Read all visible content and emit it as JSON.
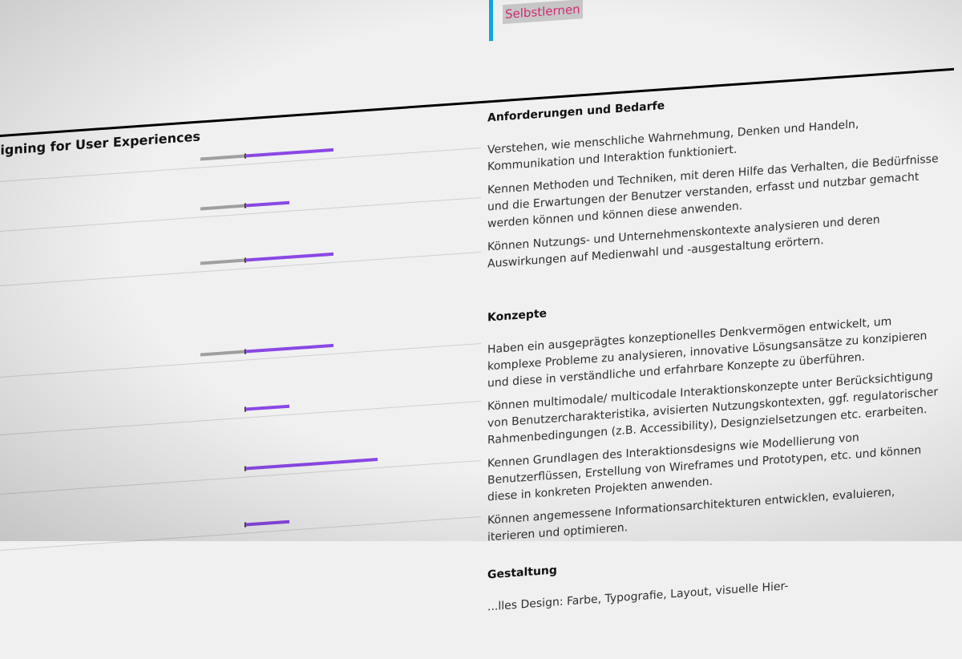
{
  "header": {
    "mode_label": "Selbstlernen"
  },
  "left": {
    "title": "esigning for User Experiences",
    "competencies": [
      {
        "level": 0.4
      },
      {
        "level": 0.2
      },
      {
        "level": 0.4
      },
      {
        "level": 0.4
      },
      {
        "level": 0.2
      },
      {
        "level": 0.6
      },
      {
        "level": 0.2
      }
    ]
  },
  "sections": [
    {
      "title": "Anforderungen und Bedarfe",
      "items": [
        "Verstehen, wie menschliche Wahrnehmung, Denken und Handeln, Kommunikation und Interaktion funktioniert.",
        "Kennen Methoden und Techniken, mit deren Hilfe das Verhalten, die Bedürfnisse und die Erwartungen der Benutzer verstanden, erfasst und nutzbar gemacht werden können und können diese anwenden.",
        "Können Nutzungs- und Unternehmenskontexte analysieren und deren Auswirkungen auf Medienwahl und -ausgestaltung erörtern."
      ]
    },
    {
      "title": "Konzepte",
      "items": [
        "Haben ein ausgeprägtes konzeptionelles Denkvermögen entwickelt, um komplexe Probleme zu analysieren, innovative Lösungsansätze zu konzipieren und diese in verständliche und erfahrbare Konzepte zu überführen.",
        "Können multimodale/ multicodale Interaktionskonzepte unter Berücksichtigung von Benutzercharakteristika, avisierten Nutzungskontexten, ggf. regulatorischer Rahmenbedingungen (z.B. Accessibility), Designzielsetzungen etc. erarbeiten.",
        "Kennen Grundlagen des Interaktionsdesigns wie Modellierung von Benutzerflüssen, Erstellung von Wireframes und Prototypen, etc. und können diese in konkreten Projekten anwenden.",
        "Können angemessene Informationsarchitekturen entwicklen, evaluieren, iterieren und optimieren."
      ]
    },
    {
      "title": "Gestaltung",
      "items": [
        "...lles Design: Farbe, Typografie, Layout, visuelle Hier-"
      ]
    }
  ],
  "colors": {
    "accent_blue": "#0ea5e0",
    "mode_text": "#cf2a74",
    "bar_fill": "#8a47e5",
    "bar_track": "#9f9f9f"
  }
}
